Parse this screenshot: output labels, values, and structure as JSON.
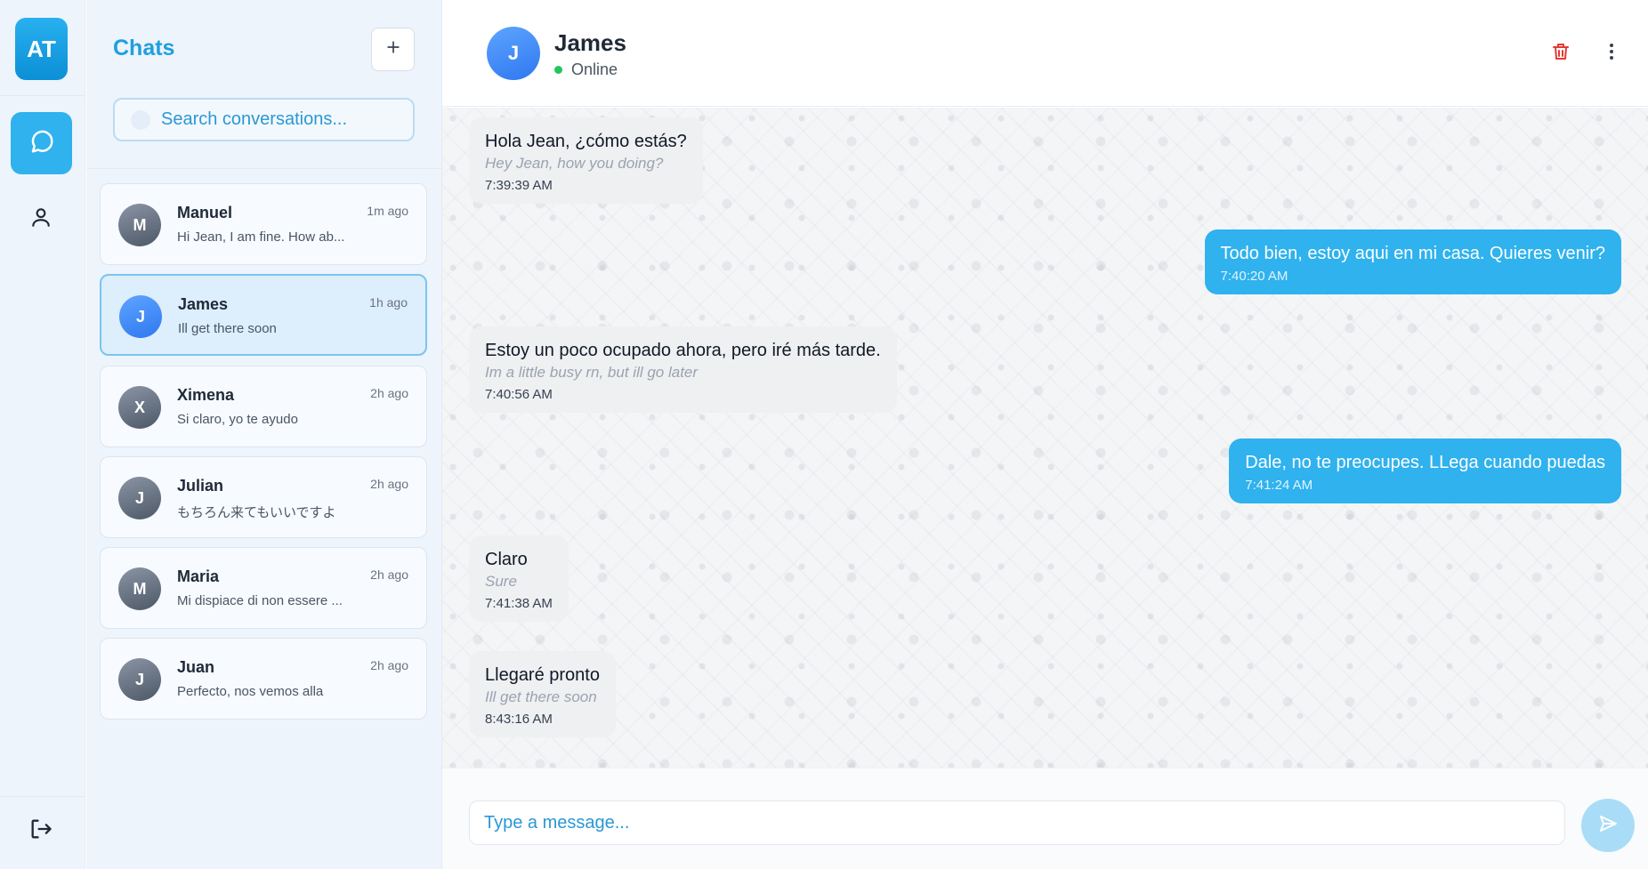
{
  "app": {
    "logo_initials": "AT",
    "accent_color": "#2fb2ee"
  },
  "rail": {
    "items": [
      {
        "icon": "chat-bubble-icon",
        "active": true
      },
      {
        "icon": "user-icon",
        "active": false
      }
    ],
    "logout_icon": "logout-icon"
  },
  "list": {
    "title": "Chats",
    "new_icon": "plus-icon",
    "search_placeholder": "Search conversations...",
    "conversations": [
      {
        "initial": "M",
        "name": "Manuel",
        "preview": "Hi Jean, I am fine. How ab...",
        "time": "1m ago",
        "active": false
      },
      {
        "initial": "J",
        "name": "James",
        "preview": "Ill get there soon",
        "time": "1h ago",
        "active": true
      },
      {
        "initial": "X",
        "name": "Ximena",
        "preview": "Si claro, yo te ayudo",
        "time": "2h ago",
        "active": false
      },
      {
        "initial": "J",
        "name": "Julian",
        "preview": "もちろん来てもいいですよ",
        "time": "2h ago",
        "active": false
      },
      {
        "initial": "M",
        "name": "Maria",
        "preview": "Mi dispiace di non essere ...",
        "time": "2h ago",
        "active": false
      },
      {
        "initial": "J",
        "name": "Juan",
        "preview": "Perfecto, nos vemos alla",
        "time": "2h ago",
        "active": false
      }
    ]
  },
  "header": {
    "initial": "J",
    "name": "James",
    "status": "Online",
    "status_color": "#22c55e",
    "delete_icon": "trash-icon",
    "menu_icon": "more-vertical-icon"
  },
  "messages": [
    {
      "dir": "in",
      "text": "Hola Jean, ¿cómo estás?",
      "translation": "Hey Jean, how you doing?",
      "time": "7:39:39 AM"
    },
    {
      "dir": "out",
      "text": "Todo bien, estoy aqui en mi casa. Quieres venir?",
      "time": "7:40:20 AM"
    },
    {
      "dir": "in",
      "text": "Estoy un poco ocupado ahora, pero iré más tarde.",
      "translation": "Im a little busy rn, but ill go later",
      "time": "7:40:56 AM"
    },
    {
      "dir": "out",
      "text": "Dale, no te preocupes. LLega cuando puedas",
      "time": "7:41:24 AM"
    },
    {
      "dir": "in",
      "text": "Claro",
      "translation": "Sure",
      "time": "7:41:38 AM"
    },
    {
      "dir": "in",
      "text": "Llegaré pronto",
      "translation": "Ill get there soon",
      "time": "8:43:16 AM"
    }
  ],
  "composer": {
    "placeholder": "Type a message...",
    "send_icon": "send-icon"
  }
}
